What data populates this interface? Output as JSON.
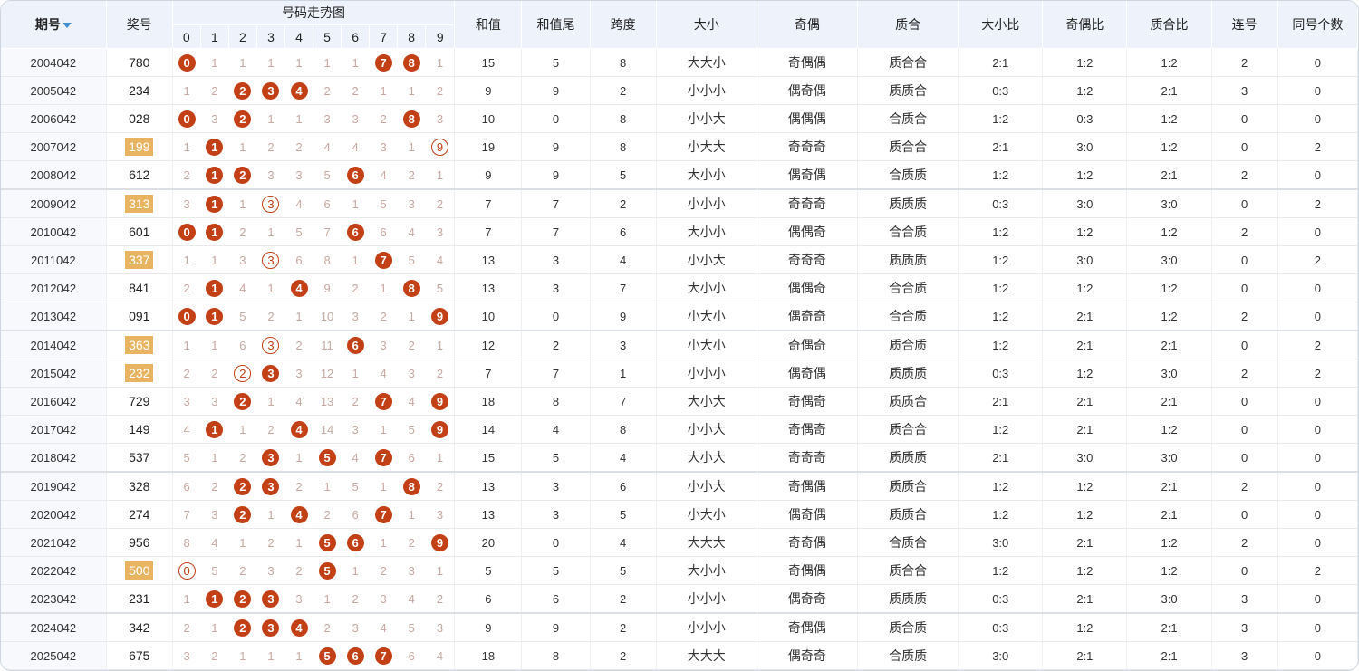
{
  "header": {
    "issue": "期号",
    "prize": "奖号",
    "trend": "号码走势图",
    "digits": [
      "0",
      "1",
      "2",
      "3",
      "4",
      "5",
      "6",
      "7",
      "8",
      "9"
    ],
    "sum": "和值",
    "sum_tail": "和值尾",
    "span": "跨度",
    "size": "大小",
    "parity": "奇偶",
    "prime": "质合",
    "size_ratio": "大小比",
    "parity_ratio": "奇偶比",
    "prime_ratio": "质合比",
    "consecutive": "连号",
    "same_count": "同号个数"
  },
  "colors": {
    "ball": "#c33f16",
    "dup_highlight": "#e8b461",
    "header_bg": "#eef3fb",
    "sort_icon": "#3b8fd9"
  },
  "rows": [
    {
      "issue": "2004042",
      "prize": "780",
      "dup": false,
      "trend": [
        "0",
        "1",
        "1",
        "1",
        "1",
        "1",
        "1",
        "7",
        "8",
        "1"
      ],
      "sum": "15",
      "tail": "5",
      "span": "8",
      "size": "大大小",
      "parity": "奇偶偶",
      "prime": "质合合",
      "sr": "2:1",
      "pr": "1:2",
      "qr": "1:2",
      "cons": "2",
      "same": "0"
    },
    {
      "issue": "2005042",
      "prize": "234",
      "dup": false,
      "trend": [
        "1",
        "2",
        "2",
        "3",
        "4",
        "2",
        "2",
        "1",
        "1",
        "2"
      ],
      "sum": "9",
      "tail": "9",
      "span": "2",
      "size": "小小小",
      "parity": "偶奇偶",
      "prime": "质质合",
      "sr": "0:3",
      "pr": "1:2",
      "qr": "2:1",
      "cons": "3",
      "same": "0"
    },
    {
      "issue": "2006042",
      "prize": "028",
      "dup": false,
      "trend": [
        "0",
        "3",
        "2",
        "1",
        "1",
        "3",
        "3",
        "2",
        "8",
        "3"
      ],
      "sum": "10",
      "tail": "0",
      "span": "8",
      "size": "小小大",
      "parity": "偶偶偶",
      "prime": "合质合",
      "sr": "1:2",
      "pr": "0:3",
      "qr": "1:2",
      "cons": "0",
      "same": "0"
    },
    {
      "issue": "2007042",
      "prize": "199",
      "dup": true,
      "trend": [
        "1",
        "1",
        "1",
        "2",
        "2",
        "4",
        "4",
        "3",
        "1",
        "9"
      ],
      "sum": "19",
      "tail": "9",
      "span": "8",
      "size": "小大大",
      "parity": "奇奇奇",
      "prime": "质合合",
      "sr": "2:1",
      "pr": "3:0",
      "qr": "1:2",
      "cons": "0",
      "same": "2"
    },
    {
      "issue": "2008042",
      "prize": "612",
      "dup": false,
      "trend": [
        "2",
        "1",
        "2",
        "3",
        "3",
        "5",
        "6",
        "4",
        "2",
        "1"
      ],
      "sum": "9",
      "tail": "9",
      "span": "5",
      "size": "大小小",
      "parity": "偶奇偶",
      "prime": "合质质",
      "sr": "1:2",
      "pr": "1:2",
      "qr": "2:1",
      "cons": "2",
      "same": "0"
    },
    {
      "issue": "2009042",
      "prize": "313",
      "dup": true,
      "trend": [
        "3",
        "1",
        "1",
        "3",
        "4",
        "6",
        "1",
        "5",
        "3",
        "2"
      ],
      "sum": "7",
      "tail": "7",
      "span": "2",
      "size": "小小小",
      "parity": "奇奇奇",
      "prime": "质质质",
      "sr": "0:3",
      "pr": "3:0",
      "qr": "3:0",
      "cons": "0",
      "same": "2"
    },
    {
      "issue": "2010042",
      "prize": "601",
      "dup": false,
      "trend": [
        "0",
        "1",
        "2",
        "1",
        "5",
        "7",
        "6",
        "6",
        "4",
        "3"
      ],
      "sum": "7",
      "tail": "7",
      "span": "6",
      "size": "大小小",
      "parity": "偶偶奇",
      "prime": "合合质",
      "sr": "1:2",
      "pr": "1:2",
      "qr": "1:2",
      "cons": "2",
      "same": "0"
    },
    {
      "issue": "2011042",
      "prize": "337",
      "dup": true,
      "trend": [
        "1",
        "1",
        "3",
        "3",
        "6",
        "8",
        "1",
        "7",
        "5",
        "4"
      ],
      "sum": "13",
      "tail": "3",
      "span": "4",
      "size": "小小大",
      "parity": "奇奇奇",
      "prime": "质质质",
      "sr": "1:2",
      "pr": "3:0",
      "qr": "3:0",
      "cons": "0",
      "same": "2"
    },
    {
      "issue": "2012042",
      "prize": "841",
      "dup": false,
      "trend": [
        "2",
        "1",
        "4",
        "1",
        "4",
        "9",
        "2",
        "1",
        "8",
        "5"
      ],
      "sum": "13",
      "tail": "3",
      "span": "7",
      "size": "大小小",
      "parity": "偶偶奇",
      "prime": "合合质",
      "sr": "1:2",
      "pr": "1:2",
      "qr": "1:2",
      "cons": "0",
      "same": "0"
    },
    {
      "issue": "2013042",
      "prize": "091",
      "dup": false,
      "trend": [
        "0",
        "1",
        "5",
        "2",
        "1",
        "10",
        "3",
        "2",
        "1",
        "9"
      ],
      "sum": "10",
      "tail": "0",
      "span": "9",
      "size": "小大小",
      "parity": "偶奇奇",
      "prime": "合合质",
      "sr": "1:2",
      "pr": "2:1",
      "qr": "1:2",
      "cons": "2",
      "same": "0"
    },
    {
      "issue": "2014042",
      "prize": "363",
      "dup": true,
      "trend": [
        "1",
        "1",
        "6",
        "3",
        "2",
        "11",
        "6",
        "3",
        "2",
        "1"
      ],
      "sum": "12",
      "tail": "2",
      "span": "3",
      "size": "小大小",
      "parity": "奇偶奇",
      "prime": "质合质",
      "sr": "1:2",
      "pr": "2:1",
      "qr": "2:1",
      "cons": "0",
      "same": "2"
    },
    {
      "issue": "2015042",
      "prize": "232",
      "dup": true,
      "trend": [
        "2",
        "2",
        "2",
        "3",
        "3",
        "12",
        "1",
        "4",
        "3",
        "2"
      ],
      "sum": "7",
      "tail": "7",
      "span": "1",
      "size": "小小小",
      "parity": "偶奇偶",
      "prime": "质质质",
      "sr": "0:3",
      "pr": "1:2",
      "qr": "3:0",
      "cons": "2",
      "same": "2"
    },
    {
      "issue": "2016042",
      "prize": "729",
      "dup": false,
      "trend": [
        "3",
        "3",
        "2",
        "1",
        "4",
        "13",
        "2",
        "7",
        "4",
        "9"
      ],
      "sum": "18",
      "tail": "8",
      "span": "7",
      "size": "大小大",
      "parity": "奇偶奇",
      "prime": "质质合",
      "sr": "2:1",
      "pr": "2:1",
      "qr": "2:1",
      "cons": "0",
      "same": "0"
    },
    {
      "issue": "2017042",
      "prize": "149",
      "dup": false,
      "trend": [
        "4",
        "1",
        "1",
        "2",
        "4",
        "14",
        "3",
        "1",
        "5",
        "9"
      ],
      "sum": "14",
      "tail": "4",
      "span": "8",
      "size": "小小大",
      "parity": "奇偶奇",
      "prime": "质合合",
      "sr": "1:2",
      "pr": "2:1",
      "qr": "1:2",
      "cons": "0",
      "same": "0"
    },
    {
      "issue": "2018042",
      "prize": "537",
      "dup": false,
      "trend": [
        "5",
        "1",
        "2",
        "3",
        "1",
        "5",
        "4",
        "7",
        "6",
        "1"
      ],
      "sum": "15",
      "tail": "5",
      "span": "4",
      "size": "大小大",
      "parity": "奇奇奇",
      "prime": "质质质",
      "sr": "2:1",
      "pr": "3:0",
      "qr": "3:0",
      "cons": "0",
      "same": "0"
    },
    {
      "issue": "2019042",
      "prize": "328",
      "dup": false,
      "trend": [
        "6",
        "2",
        "2",
        "3",
        "2",
        "1",
        "5",
        "1",
        "8",
        "2"
      ],
      "sum": "13",
      "tail": "3",
      "span": "6",
      "size": "小小大",
      "parity": "奇偶偶",
      "prime": "质质合",
      "sr": "1:2",
      "pr": "1:2",
      "qr": "2:1",
      "cons": "2",
      "same": "0"
    },
    {
      "issue": "2020042",
      "prize": "274",
      "dup": false,
      "trend": [
        "7",
        "3",
        "2",
        "1",
        "4",
        "2",
        "6",
        "7",
        "1",
        "3"
      ],
      "sum": "13",
      "tail": "3",
      "span": "5",
      "size": "小大小",
      "parity": "偶奇偶",
      "prime": "质质合",
      "sr": "1:2",
      "pr": "1:2",
      "qr": "2:1",
      "cons": "0",
      "same": "0"
    },
    {
      "issue": "2021042",
      "prize": "956",
      "dup": false,
      "trend": [
        "8",
        "4",
        "1",
        "2",
        "1",
        "5",
        "6",
        "1",
        "2",
        "9"
      ],
      "sum": "20",
      "tail": "0",
      "span": "4",
      "size": "大大大",
      "parity": "奇奇偶",
      "prime": "合质合",
      "sr": "3:0",
      "pr": "2:1",
      "qr": "1:2",
      "cons": "2",
      "same": "0"
    },
    {
      "issue": "2022042",
      "prize": "500",
      "dup": true,
      "trend": [
        "0",
        "5",
        "2",
        "3",
        "2",
        "5",
        "1",
        "2",
        "3",
        "1"
      ],
      "sum": "5",
      "tail": "5",
      "span": "5",
      "size": "大小小",
      "parity": "奇偶偶",
      "prime": "质合合",
      "sr": "1:2",
      "pr": "1:2",
      "qr": "1:2",
      "cons": "0",
      "same": "2"
    },
    {
      "issue": "2023042",
      "prize": "231",
      "dup": false,
      "trend": [
        "1",
        "1",
        "2",
        "3",
        "3",
        "1",
        "2",
        "3",
        "4",
        "2"
      ],
      "sum": "6",
      "tail": "6",
      "span": "2",
      "size": "小小小",
      "parity": "偶奇奇",
      "prime": "质质质",
      "sr": "0:3",
      "pr": "2:1",
      "qr": "3:0",
      "cons": "3",
      "same": "0"
    },
    {
      "issue": "2024042",
      "prize": "342",
      "dup": false,
      "trend": [
        "2",
        "1",
        "2",
        "3",
        "4",
        "2",
        "3",
        "4",
        "5",
        "3"
      ],
      "sum": "9",
      "tail": "9",
      "span": "2",
      "size": "小小小",
      "parity": "奇偶偶",
      "prime": "质合质",
      "sr": "0:3",
      "pr": "1:2",
      "qr": "2:1",
      "cons": "3",
      "same": "0"
    },
    {
      "issue": "2025042",
      "prize": "675",
      "dup": false,
      "trend": [
        "3",
        "2",
        "1",
        "1",
        "1",
        "5",
        "6",
        "7",
        "6",
        "4"
      ],
      "sum": "18",
      "tail": "8",
      "span": "2",
      "size": "大大大",
      "parity": "偶奇奇",
      "prime": "合质质",
      "sr": "3:0",
      "pr": "2:1",
      "qr": "2:1",
      "cons": "3",
      "same": "0"
    }
  ]
}
